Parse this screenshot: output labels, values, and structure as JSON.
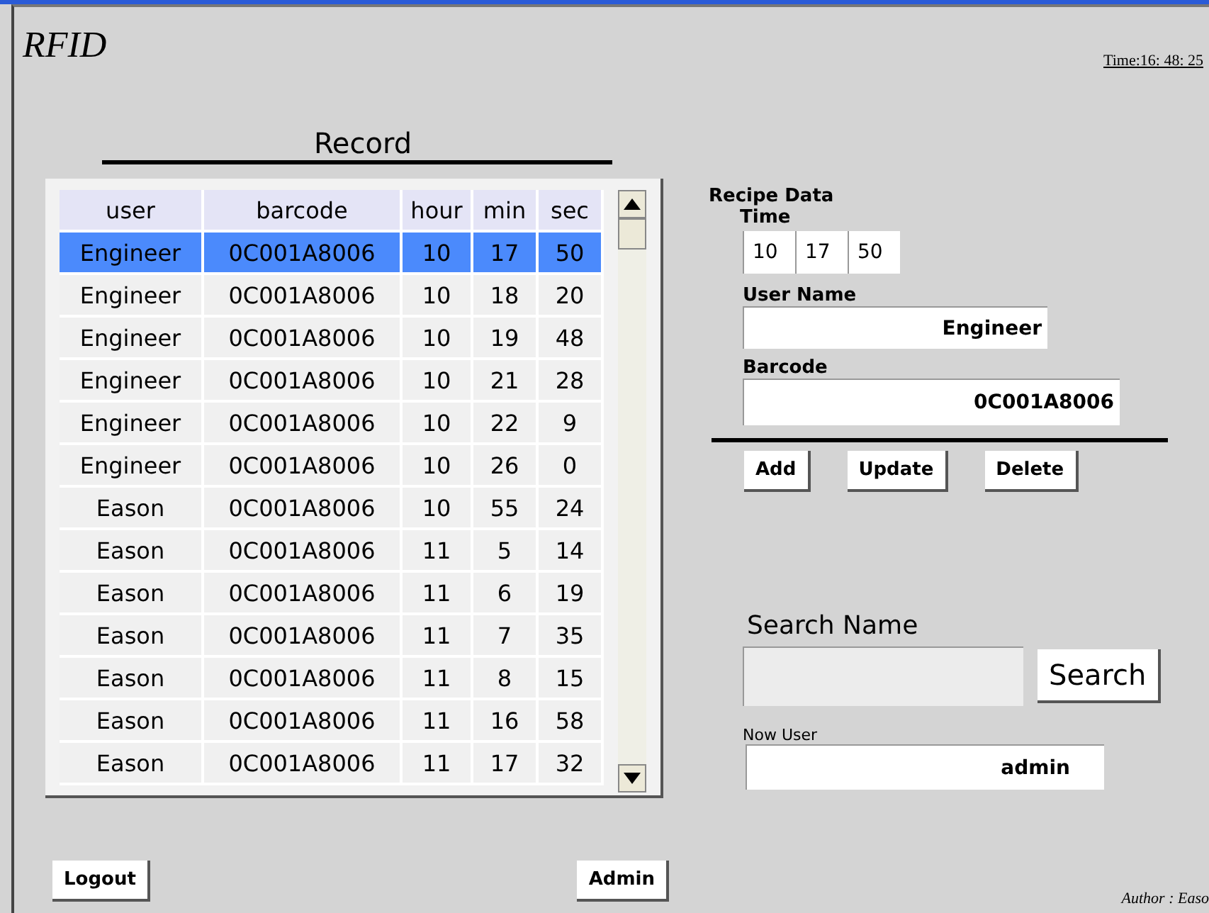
{
  "title": "RFID",
  "clock": "Time:16: 48: 25",
  "record": {
    "title": "Record",
    "columns": [
      "user",
      "barcode",
      "hour",
      "min",
      "sec"
    ],
    "rows": [
      {
        "cells": [
          "Engineer",
          "0C001A8006",
          "10",
          "17",
          "50"
        ],
        "selected": true
      },
      {
        "cells": [
          "Engineer",
          "0C001A8006",
          "10",
          "18",
          "20"
        ],
        "selected": false
      },
      {
        "cells": [
          "Engineer",
          "0C001A8006",
          "10",
          "19",
          "48"
        ],
        "selected": false
      },
      {
        "cells": [
          "Engineer",
          "0C001A8006",
          "10",
          "21",
          "28"
        ],
        "selected": false
      },
      {
        "cells": [
          "Engineer",
          "0C001A8006",
          "10",
          "22",
          "9"
        ],
        "selected": false
      },
      {
        "cells": [
          "Engineer",
          "0C001A8006",
          "10",
          "26",
          "0"
        ],
        "selected": false
      },
      {
        "cells": [
          "Eason",
          "0C001A8006",
          "10",
          "55",
          "24"
        ],
        "selected": false
      },
      {
        "cells": [
          "Eason",
          "0C001A8006",
          "11",
          "5",
          "14"
        ],
        "selected": false
      },
      {
        "cells": [
          "Eason",
          "0C001A8006",
          "11",
          "6",
          "19"
        ],
        "selected": false
      },
      {
        "cells": [
          "Eason",
          "0C001A8006",
          "11",
          "7",
          "35"
        ],
        "selected": false
      },
      {
        "cells": [
          "Eason",
          "0C001A8006",
          "11",
          "8",
          "15"
        ],
        "selected": false
      },
      {
        "cells": [
          "Eason",
          "0C001A8006",
          "11",
          "16",
          "58"
        ],
        "selected": false
      },
      {
        "cells": [
          "Eason",
          "0C001A8006",
          "11",
          "17",
          "32"
        ],
        "selected": false
      }
    ]
  },
  "recipe": {
    "title": "Recipe Data",
    "time_label": "Time",
    "time": [
      "10",
      "17",
      "50"
    ],
    "user_label": "User Name",
    "user": "Engineer",
    "barcode_label": "Barcode",
    "barcode": "0C001A8006",
    "buttons": [
      "Add",
      "Update",
      "Delete"
    ]
  },
  "search": {
    "label": "Search Name",
    "button": "Search"
  },
  "now_user": {
    "label": "Now User",
    "value": "admin"
  },
  "footer": {
    "logout": "Logout",
    "admin": "Admin",
    "author": "Author : Easo"
  }
}
